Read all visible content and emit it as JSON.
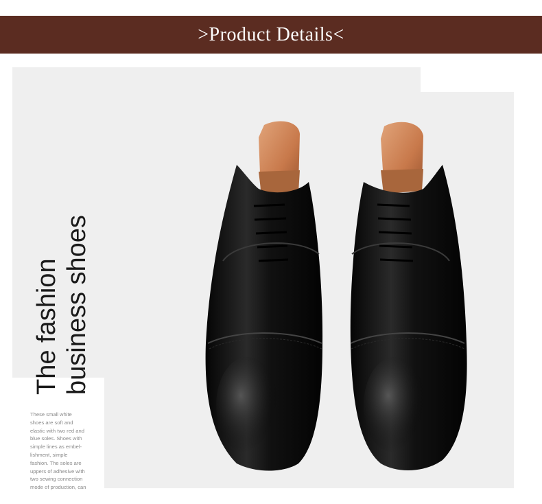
{
  "header": {
    "title": ">Product Details<"
  },
  "hero": {
    "headline_line1": "The fashion",
    "headline_line2": "business shoes"
  },
  "description": {
    "lines": [
      "These small white",
      "shoes are soft and",
      "elastic with two red and",
      "blue soles. Shoes with",
      "simple lines as embel-",
      "lishment, simple",
      "fashion. The soles are",
      "uppers of adhesive with",
      "two sewing connection",
      "mode of production, can"
    ]
  },
  "colors": {
    "header_bg": "#5b2c21",
    "panel_bg": "#efefef",
    "leather": "#111111",
    "shoe_tree": "#c8794b"
  },
  "product_image": {
    "icon": "black-oxford-shoes-image"
  }
}
